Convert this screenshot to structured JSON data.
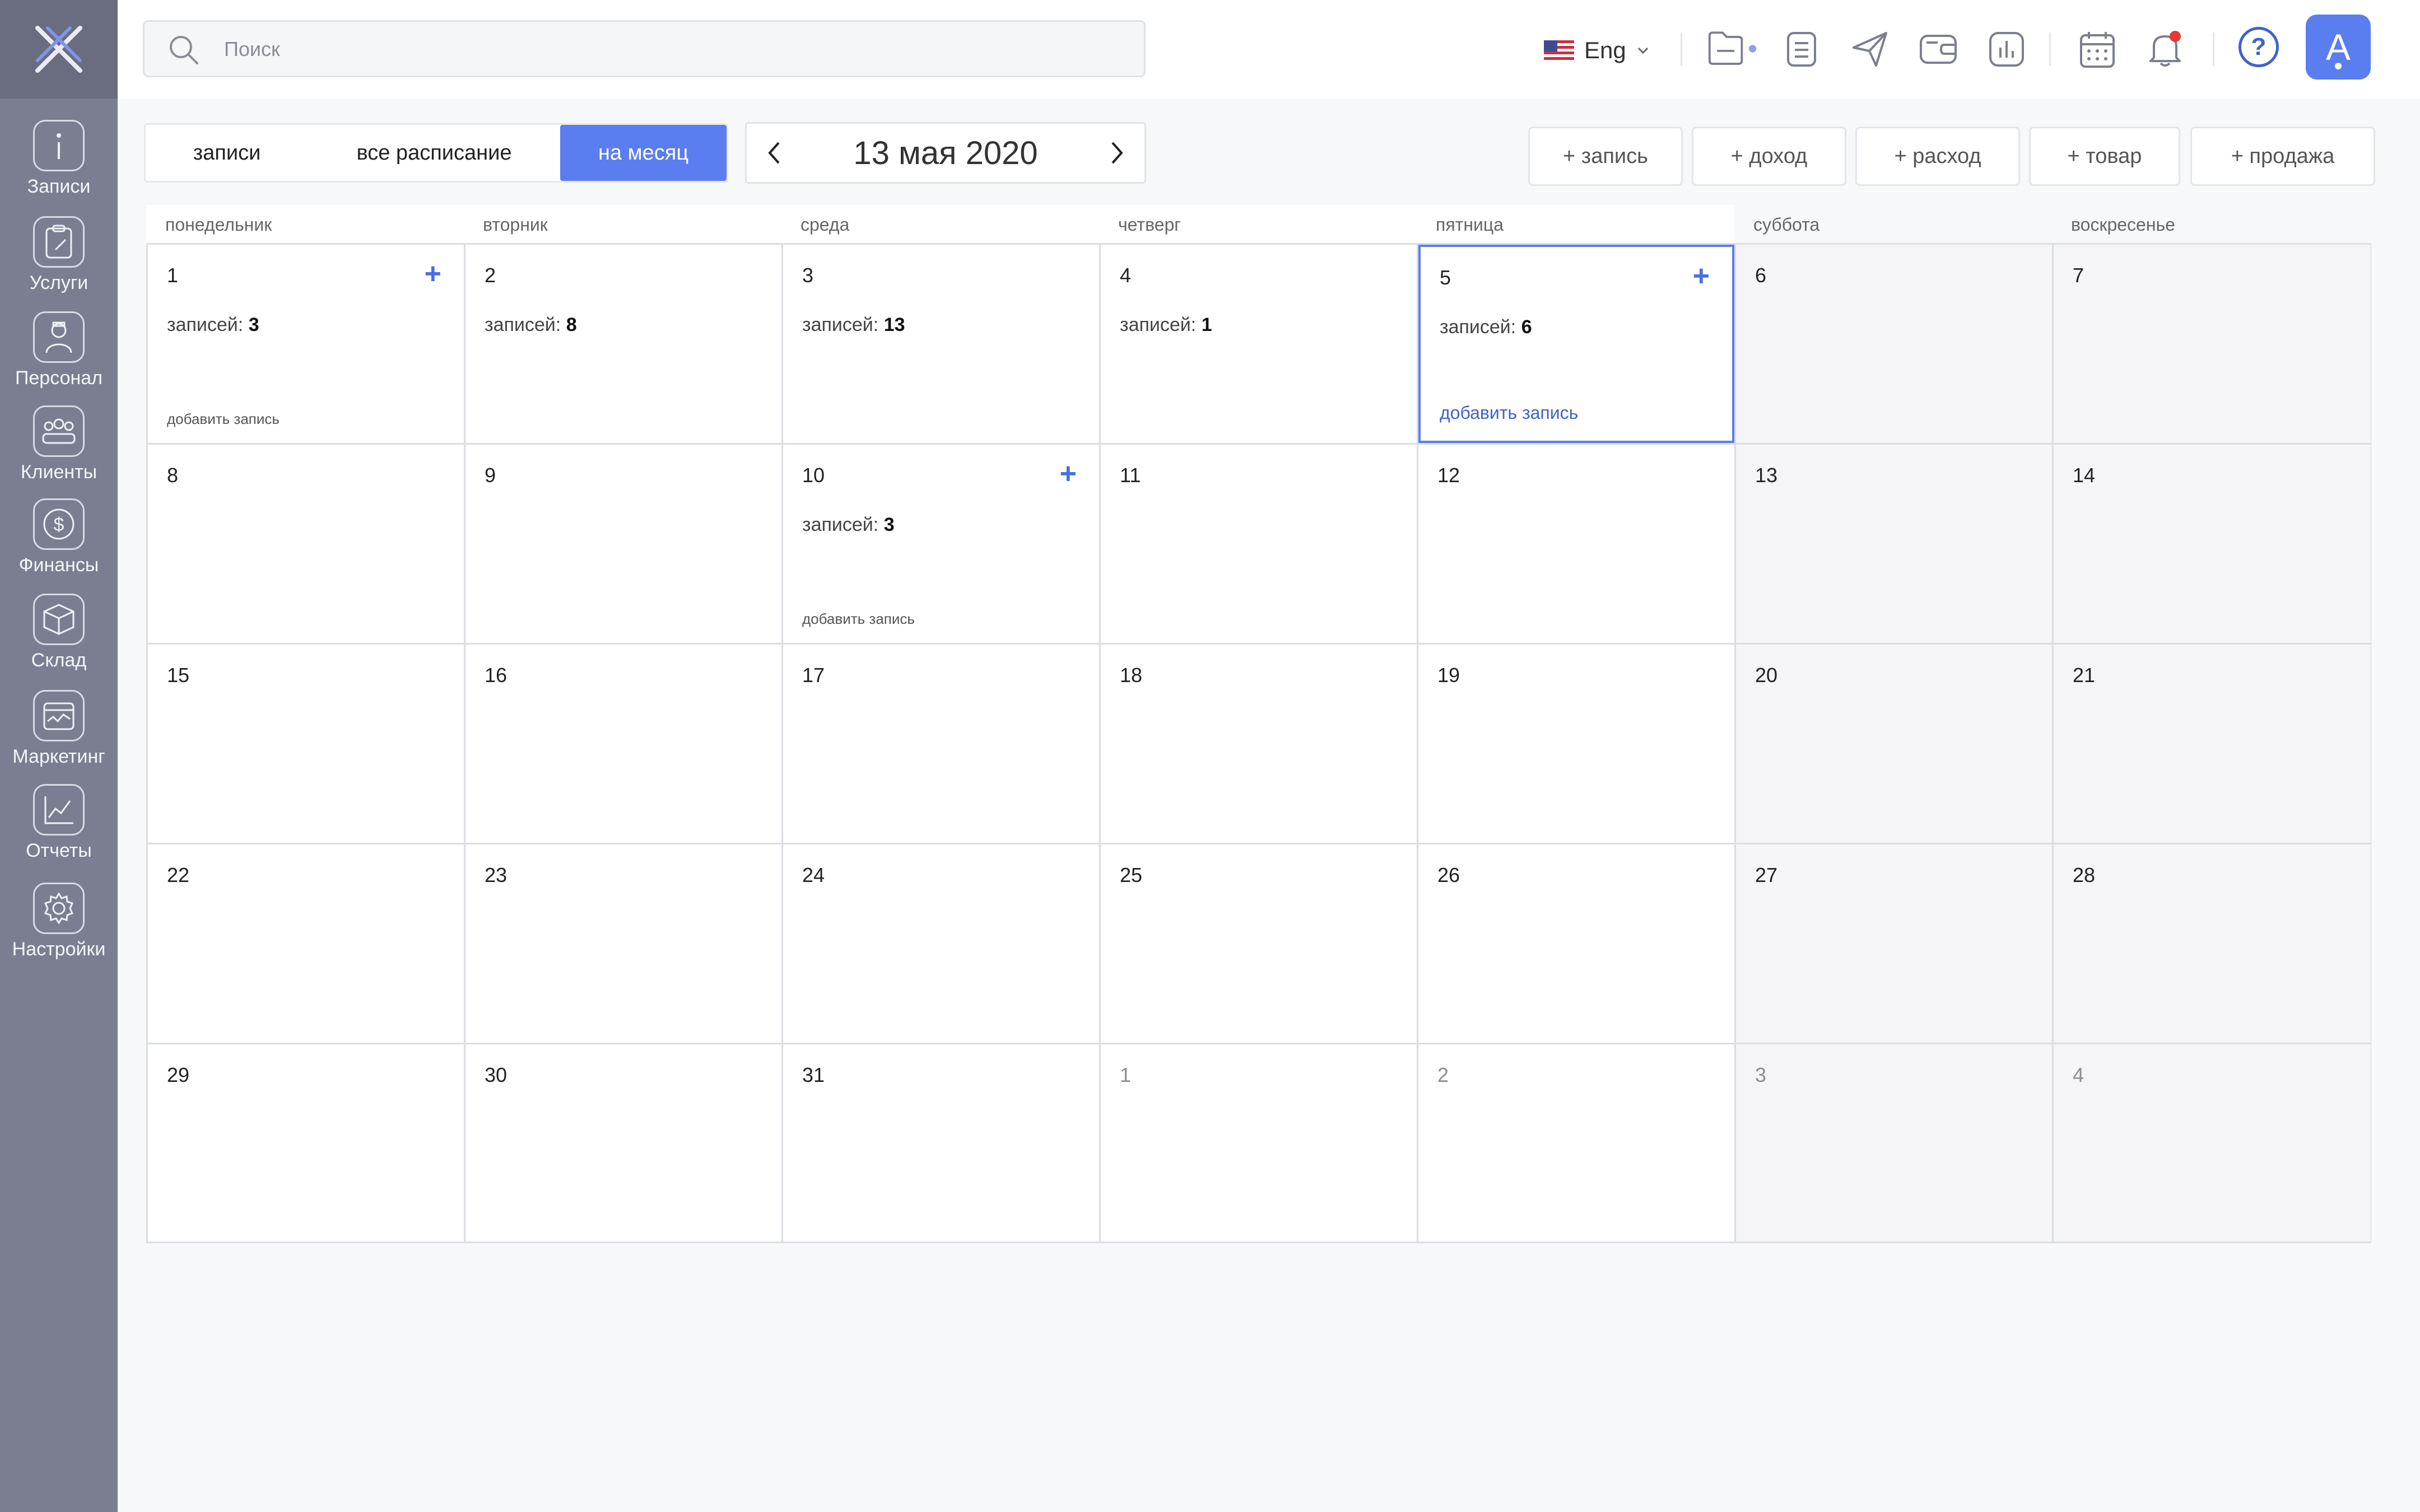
{
  "sidebar": {
    "items": [
      {
        "label": "Записи",
        "icon": "info-icon"
      },
      {
        "label": "Услуги",
        "icon": "clipboard-icon"
      },
      {
        "label": "Персонал",
        "icon": "staff-icon"
      },
      {
        "label": "Клиенты",
        "icon": "clients-icon"
      },
      {
        "label": "Финансы",
        "icon": "dollar-icon"
      },
      {
        "label": "Склад",
        "icon": "box-icon"
      },
      {
        "label": "Маркетинг",
        "icon": "marketing-icon"
      },
      {
        "label": "Отчеты",
        "icon": "chart-icon"
      },
      {
        "label": "Настройки",
        "icon": "gear-icon"
      }
    ]
  },
  "topbar": {
    "search_placeholder": "Поиск",
    "language": "Eng",
    "avatar_letter": "A",
    "help_label": "?"
  },
  "view_tabs": [
    {
      "label": "записи"
    },
    {
      "label": "все расписание"
    },
    {
      "label": "на месяц",
      "active": true
    }
  ],
  "date_nav": {
    "current": "13 мая 2020"
  },
  "quick_actions": [
    "+ запись",
    "+ доход",
    "+ расход",
    "+ товар",
    "+ продажа"
  ],
  "weekdays": [
    "понедельник",
    "вторник",
    "среда",
    "четверг",
    "пятница",
    "суббота",
    "воскресенье"
  ],
  "count_label": "записей:",
  "add_record_label": "добавить запись",
  "calendar": [
    [
      {
        "d": "1",
        "count": "3",
        "plus": true,
        "add": "gray"
      },
      {
        "d": "2",
        "count": "8"
      },
      {
        "d": "3",
        "count": "13"
      },
      {
        "d": "4",
        "count": "1"
      },
      {
        "d": "5",
        "count": "6",
        "plus": true,
        "add": "blue",
        "selected": true
      },
      {
        "d": "6"
      },
      {
        "d": "7"
      }
    ],
    [
      {
        "d": "8"
      },
      {
        "d": "9"
      },
      {
        "d": "10",
        "count": "3",
        "plus": true,
        "add": "gray"
      },
      {
        "d": "11"
      },
      {
        "d": "12"
      },
      {
        "d": "13"
      },
      {
        "d": "14"
      }
    ],
    [
      {
        "d": "15"
      },
      {
        "d": "16"
      },
      {
        "d": "17"
      },
      {
        "d": "18"
      },
      {
        "d": "19"
      },
      {
        "d": "20"
      },
      {
        "d": "21"
      }
    ],
    [
      {
        "d": "22"
      },
      {
        "d": "23"
      },
      {
        "d": "24"
      },
      {
        "d": "25"
      },
      {
        "d": "26"
      },
      {
        "d": "27"
      },
      {
        "d": "28"
      }
    ],
    [
      {
        "d": "29"
      },
      {
        "d": "30"
      },
      {
        "d": "31"
      },
      {
        "d": "1",
        "other": true
      },
      {
        "d": "2",
        "other": true
      },
      {
        "d": "3",
        "other": true
      },
      {
        "d": "4",
        "other": true
      }
    ]
  ]
}
